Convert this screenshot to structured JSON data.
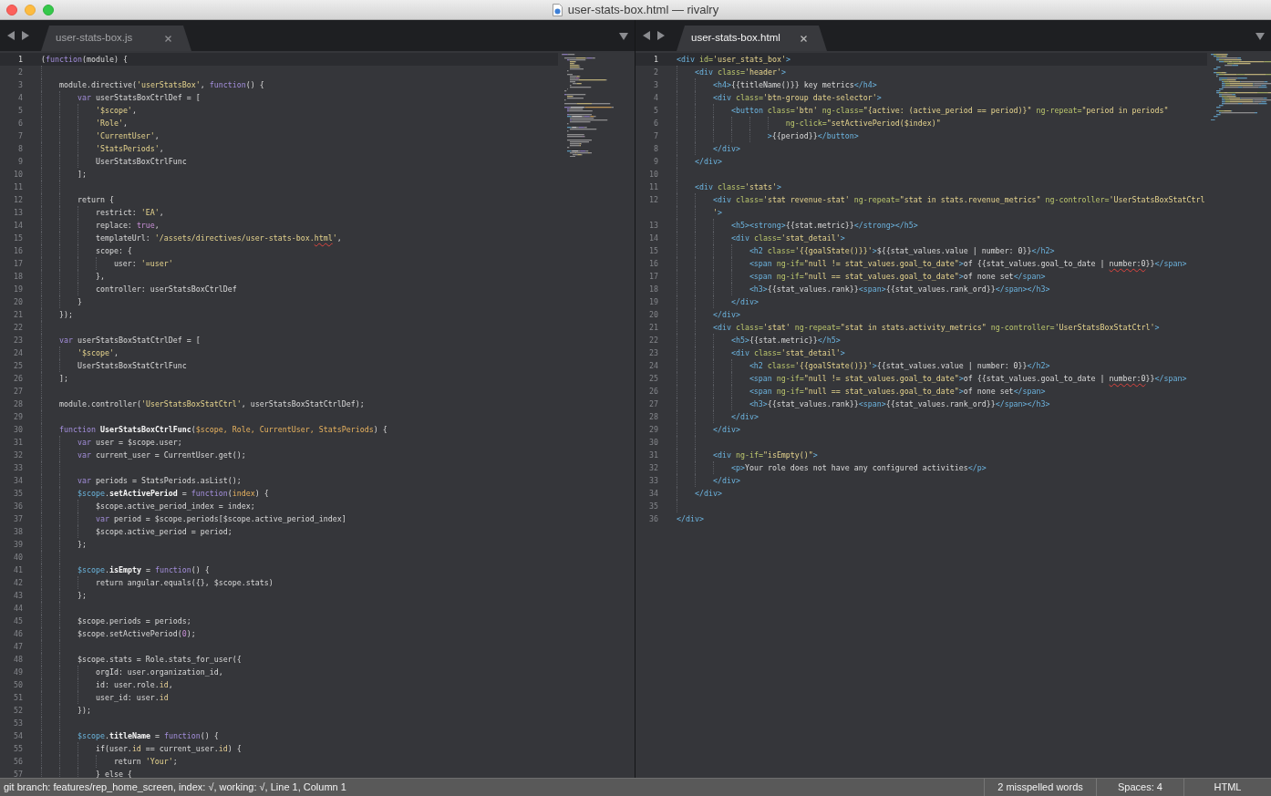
{
  "window": {
    "title": "user-stats-box.html — rivalry"
  },
  "panes": [
    {
      "tab": {
        "label": "user-stats-box.js",
        "focused": false
      },
      "lines": [
        {
          "number": "1",
          "current": true,
          "tokens": [
            {
              "kind": "plain",
              "text": "("
            },
            {
              "kind": "keyword",
              "text": "function"
            },
            {
              "kind": "plain",
              "text": "(module) {"
            }
          ]
        },
        {
          "number": "2",
          "current": false
        },
        {
          "number": "3",
          "current": false,
          "tokens": [
            {
              "kind": "plain",
              "text": "    module.directive("
            },
            {
              "kind": "string",
              "text": "'userStatsBox'"
            },
            {
              "kind": "plain",
              "text": ", "
            },
            {
              "kind": "keyword",
              "text": "function"
            },
            {
              "kind": "plain",
              "text": "() {"
            }
          ]
        },
        {
          "number": "4",
          "current": false,
          "tokens": [
            {
              "kind": "keyword",
              "text": "        var"
            },
            {
              "kind": "plain",
              "text": " userStatsBoxCtrlDef = ["
            }
          ]
        },
        {
          "number": "5",
          "current": false,
          "tokens": [
            {
              "kind": "string",
              "text": "            '$scope'"
            },
            {
              "kind": "plain",
              "text": ","
            }
          ]
        },
        {
          "number": "6",
          "current": false,
          "tokens": [
            {
              "kind": "string",
              "text": "            'Role'"
            },
            {
              "kind": "plain",
              "text": ","
            }
          ]
        },
        {
          "number": "7",
          "current": false,
          "tokens": [
            {
              "kind": "string",
              "text": "            'CurrentUser'"
            },
            {
              "kind": "plain",
              "text": ","
            }
          ]
        },
        {
          "number": "8",
          "current": false,
          "tokens": [
            {
              "kind": "string",
              "text": "            'StatsPeriods'"
            },
            {
              "kind": "plain",
              "text": ","
            }
          ]
        },
        {
          "number": "9",
          "current": false,
          "tokens": [
            {
              "kind": "plain",
              "text": "            UserStatsBoxCtrlFunc"
            }
          ]
        },
        {
          "number": "10",
          "current": false,
          "tokens": [
            {
              "kind": "plain",
              "text": "        ];"
            }
          ]
        },
        {
          "number": "11",
          "current": false
        },
        {
          "number": "12",
          "current": false,
          "tokens": [
            {
              "kind": "plain",
              "text": "        return {"
            }
          ]
        },
        {
          "number": "13",
          "current": false,
          "tokens": [
            {
              "kind": "plain",
              "text": "            restrict: "
            },
            {
              "kind": "string",
              "text": "'EA'"
            },
            {
              "kind": "plain",
              "text": ","
            }
          ]
        },
        {
          "number": "14",
          "current": false,
          "tokens": [
            {
              "kind": "plain",
              "text": "            replace: "
            },
            {
              "kind": "constant",
              "text": "true"
            },
            {
              "kind": "plain",
              "text": ","
            }
          ]
        },
        {
          "number": "15",
          "current": false,
          "tokens": [
            {
              "kind": "plain",
              "text": "            templateUrl: "
            },
            {
              "kind": "string",
              "text": "'/assets/directives/user-stats-box."
            },
            {
              "kind": "misspelled_string",
              "text": "html"
            },
            {
              "kind": "string",
              "text": "'"
            },
            {
              "kind": "plain",
              "text": ","
            }
          ]
        },
        {
          "number": "16",
          "current": false,
          "tokens": [
            {
              "kind": "plain",
              "text": "            scope: {"
            }
          ]
        },
        {
          "number": "17",
          "current": false,
          "tokens": [
            {
              "kind": "plain",
              "text": "                user: "
            },
            {
              "kind": "string",
              "text": "'=user'"
            }
          ]
        },
        {
          "number": "18",
          "current": false,
          "tokens": [
            {
              "kind": "plain",
              "text": "            },"
            }
          ]
        },
        {
          "number": "19",
          "current": false,
          "tokens": [
            {
              "kind": "plain",
              "text": "            controller: userStatsBoxCtrlDef"
            }
          ]
        },
        {
          "number": "20",
          "current": false,
          "tokens": [
            {
              "kind": "plain",
              "text": "        }"
            }
          ]
        },
        {
          "number": "21",
          "current": false,
          "tokens": [
            {
              "kind": "plain",
              "text": "    });"
            }
          ]
        },
        {
          "number": "22",
          "current": false
        },
        {
          "number": "23",
          "current": false,
          "tokens": [
            {
              "kind": "keyword",
              "text": "    var"
            },
            {
              "kind": "plain",
              "text": " userStatsBoxStatCtrlDef = ["
            }
          ]
        },
        {
          "number": "24",
          "current": false,
          "tokens": [
            {
              "kind": "string",
              "text": "        '$scope'"
            },
            {
              "kind": "plain",
              "text": ","
            }
          ]
        },
        {
          "number": "25",
          "current": false,
          "tokens": [
            {
              "kind": "plain",
              "text": "        UserStatsBoxStatCtrlFunc"
            }
          ]
        },
        {
          "number": "26",
          "current": false,
          "tokens": [
            {
              "kind": "plain",
              "text": "    ];"
            }
          ]
        },
        {
          "number": "27",
          "current": false
        },
        {
          "number": "28",
          "current": false,
          "tokens": [
            {
              "kind": "plain",
              "text": "    module.controller("
            },
            {
              "kind": "string",
              "text": "'UserStatsBoxStatCtrl'"
            },
            {
              "kind": "plain",
              "text": ", userStatsBoxStatCtrlDef);"
            }
          ]
        },
        {
          "number": "29",
          "current": false
        },
        {
          "number": "30",
          "current": false,
          "tokens": [
            {
              "kind": "keyword",
              "text": "    function "
            },
            {
              "kind": "entity",
              "text": "UserStatsBoxCtrlFunc"
            },
            {
              "kind": "plain",
              "text": "("
            },
            {
              "kind": "param",
              "text": "$scope, Role, CurrentUser, StatsPeriods"
            },
            {
              "kind": "plain",
              "text": ") {"
            }
          ]
        },
        {
          "number": "31",
          "current": false,
          "tokens": [
            {
              "kind": "keyword",
              "text": "        var"
            },
            {
              "kind": "plain",
              "text": " user = $scope.user;"
            }
          ]
        },
        {
          "number": "32",
          "current": false,
          "tokens": [
            {
              "kind": "keyword",
              "text": "        var"
            },
            {
              "kind": "plain",
              "text": " current_user = CurrentUser.get();"
            }
          ]
        },
        {
          "number": "33",
          "current": false
        },
        {
          "number": "34",
          "current": false,
          "tokens": [
            {
              "kind": "keyword",
              "text": "        var"
            },
            {
              "kind": "plain",
              "text": " periods = StatsPeriods.asList();"
            }
          ]
        },
        {
          "number": "35",
          "current": false,
          "tokens": [
            {
              "kind": "variable",
              "text": "        $scope"
            },
            {
              "kind": "plain",
              "text": "."
            },
            {
              "kind": "entity",
              "text": "setActivePeriod"
            },
            {
              "kind": "plain",
              "text": " = "
            },
            {
              "kind": "keyword",
              "text": "function"
            },
            {
              "kind": "plain",
              "text": "("
            },
            {
              "kind": "param",
              "text": "index"
            },
            {
              "kind": "plain",
              "text": ") {"
            }
          ]
        },
        {
          "number": "36",
          "current": false,
          "tokens": [
            {
              "kind": "plain",
              "text": "            $scope.active_period_index = index;"
            }
          ]
        },
        {
          "number": "37",
          "current": false,
          "tokens": [
            {
              "kind": "keyword",
              "text": "            var"
            },
            {
              "kind": "plain",
              "text": " period = $scope.periods[$scope.active_period_index]"
            }
          ]
        },
        {
          "number": "38",
          "current": false,
          "tokens": [
            {
              "kind": "plain",
              "text": "            $scope.active_period = period;"
            }
          ]
        },
        {
          "number": "39",
          "current": false,
          "tokens": [
            {
              "kind": "plain",
              "text": "        };"
            }
          ]
        },
        {
          "number": "40",
          "current": false
        },
        {
          "number": "41",
          "current": false,
          "tokens": [
            {
              "kind": "variable",
              "text": "        $scope"
            },
            {
              "kind": "plain",
              "text": "."
            },
            {
              "kind": "entity",
              "text": "isEmpty"
            },
            {
              "kind": "plain",
              "text": " = "
            },
            {
              "kind": "keyword",
              "text": "function"
            },
            {
              "kind": "plain",
              "text": "() {"
            }
          ]
        },
        {
          "number": "42",
          "current": false,
          "tokens": [
            {
              "kind": "plain",
              "text": "            return angular.equals({}, $scope.stats)"
            }
          ]
        },
        {
          "number": "43",
          "current": false,
          "tokens": [
            {
              "kind": "plain",
              "text": "        };"
            }
          ]
        },
        {
          "number": "44",
          "current": false
        },
        {
          "number": "45",
          "current": false,
          "tokens": [
            {
              "kind": "plain",
              "text": "        $scope.periods = periods;"
            }
          ]
        },
        {
          "number": "46",
          "current": false,
          "tokens": [
            {
              "kind": "plain",
              "text": "        $scope.setActivePeriod("
            },
            {
              "kind": "constant",
              "text": "0"
            },
            {
              "kind": "plain",
              "text": ");"
            }
          ]
        },
        {
          "number": "47",
          "current": false
        },
        {
          "number": "48",
          "current": false,
          "tokens": [
            {
              "kind": "plain",
              "text": "        $scope.stats = Role.stats_for_user({"
            }
          ]
        },
        {
          "number": "49",
          "current": false,
          "tokens": [
            {
              "kind": "plain",
              "text": "            orgId: user.organization_id,"
            }
          ]
        },
        {
          "number": "50",
          "current": false,
          "tokens": [
            {
              "kind": "plain",
              "text": "            id: user.role."
            },
            {
              "kind": "property",
              "text": "id"
            },
            {
              "kind": "plain",
              "text": ","
            }
          ]
        },
        {
          "number": "51",
          "current": false,
          "tokens": [
            {
              "kind": "plain",
              "text": "            user_id: user."
            },
            {
              "kind": "property",
              "text": "id"
            }
          ]
        },
        {
          "number": "52",
          "current": false,
          "tokens": [
            {
              "kind": "plain",
              "text": "        });"
            }
          ]
        },
        {
          "number": "53",
          "current": false
        },
        {
          "number": "54",
          "current": false,
          "tokens": [
            {
              "kind": "variable",
              "text": "        $scope"
            },
            {
              "kind": "plain",
              "text": "."
            },
            {
              "kind": "entity",
              "text": "titleName"
            },
            {
              "kind": "plain",
              "text": " = "
            },
            {
              "kind": "keyword",
              "text": "function"
            },
            {
              "kind": "plain",
              "text": "() {"
            }
          ]
        },
        {
          "number": "55",
          "current": false,
          "tokens": [
            {
              "kind": "plain",
              "text": "            if(user."
            },
            {
              "kind": "property",
              "text": "id"
            },
            {
              "kind": "plain",
              "text": " == current_user."
            },
            {
              "kind": "property",
              "text": "id"
            },
            {
              "kind": "plain",
              "text": ") {"
            }
          ]
        },
        {
          "number": "56",
          "current": false,
          "tokens": [
            {
              "kind": "plain",
              "text": "                return "
            },
            {
              "kind": "string",
              "text": "'Your'"
            },
            {
              "kind": "plain",
              "text": ";"
            }
          ]
        },
        {
          "number": "57",
          "current": false,
          "tokens": [
            {
              "kind": "plain",
              "text": "            } else {"
            }
          ]
        }
      ]
    },
    {
      "tab": {
        "label": "user-stats-box.html",
        "focused": true
      },
      "lines": [
        {
          "number": "1",
          "current": true,
          "tokens": [
            {
              "kind": "tag",
              "text": "<div"
            },
            {
              "kind": "attr",
              "text": " id="
            },
            {
              "kind": "string",
              "text": "'user_stats_box'"
            },
            {
              "kind": "tag",
              "text": ">"
            }
          ]
        },
        {
          "number": "2",
          "current": false,
          "tokens": [
            {
              "kind": "tag",
              "text": "    <div"
            },
            {
              "kind": "attr",
              "text": " class="
            },
            {
              "kind": "string",
              "text": "'header'"
            },
            {
              "kind": "tag",
              "text": ">"
            }
          ]
        },
        {
          "number": "3",
          "current": false,
          "tokens": [
            {
              "kind": "tag",
              "text": "        <h4>"
            },
            {
              "kind": "plain",
              "text": "{{titleName()}} key metrics"
            },
            {
              "kind": "tag",
              "text": "</h4>"
            }
          ]
        },
        {
          "number": "4",
          "current": false,
          "tokens": [
            {
              "kind": "tag",
              "text": "        <div"
            },
            {
              "kind": "attr",
              "text": " class="
            },
            {
              "kind": "string",
              "text": "'btn-group date-selector'"
            },
            {
              "kind": "tag",
              "text": ">"
            }
          ]
        },
        {
          "number": "5",
          "current": false,
          "tokens": [
            {
              "kind": "tag",
              "text": "            <button"
            },
            {
              "kind": "attr",
              "text": " class="
            },
            {
              "kind": "string",
              "text": "'btn'"
            },
            {
              "kind": "attr",
              "text": " ng-class="
            },
            {
              "kind": "string",
              "text": "\"{active: (active_period == period)}\""
            },
            {
              "kind": "attr",
              "text": " ng-repeat="
            },
            {
              "kind": "string",
              "text": "\"period in periods\""
            }
          ]
        },
        {
          "number": "6",
          "current": false,
          "tokens": [
            {
              "kind": "attr",
              "text": "                        ng-click="
            },
            {
              "kind": "string",
              "text": "\"setActivePeriod($index)\""
            }
          ]
        },
        {
          "number": "7",
          "current": false,
          "tokens": [
            {
              "kind": "tag",
              "text": "                    >"
            },
            {
              "kind": "plain",
              "text": "{{period}}"
            },
            {
              "kind": "tag",
              "text": "</button>"
            }
          ]
        },
        {
          "number": "8",
          "current": false,
          "tokens": [
            {
              "kind": "tag",
              "text": "        </div>"
            }
          ]
        },
        {
          "number": "9",
          "current": false,
          "tokens": [
            {
              "kind": "tag",
              "text": "    </div>"
            }
          ]
        },
        {
          "number": "10",
          "current": false
        },
        {
          "number": "11",
          "current": false,
          "tokens": [
            {
              "kind": "tag",
              "text": "    <div"
            },
            {
              "kind": "attr",
              "text": " class="
            },
            {
              "kind": "string",
              "text": "'stats'"
            },
            {
              "kind": "tag",
              "text": ">"
            }
          ]
        },
        {
          "number": "12",
          "current": false,
          "tokens": [
            {
              "kind": "tag",
              "text": "        <div"
            },
            {
              "kind": "attr",
              "text": " class="
            },
            {
              "kind": "string",
              "text": "'stat revenue-stat'"
            },
            {
              "kind": "attr",
              "text": " ng-repeat="
            },
            {
              "kind": "string",
              "text": "\"stat in stats.revenue_metrics\""
            },
            {
              "kind": "attr",
              "text": " ng-controller="
            },
            {
              "kind": "string",
              "text": "'UserStatsBoxStatCtrl"
            }
          ],
          "wrap": [
            {
              "kind": "string",
              "text": "'"
            },
            {
              "kind": "tag",
              "text": ">"
            }
          ]
        },
        {
          "number": "13",
          "current": false,
          "tokens": [
            {
              "kind": "tag",
              "text": "            <h5><strong>"
            },
            {
              "kind": "plain",
              "text": "{{stat.metric}}"
            },
            {
              "kind": "tag",
              "text": "</strong></h5>"
            }
          ]
        },
        {
          "number": "14",
          "current": false,
          "tokens": [
            {
              "kind": "tag",
              "text": "            <div"
            },
            {
              "kind": "attr",
              "text": " class="
            },
            {
              "kind": "string",
              "text": "'stat_detail'"
            },
            {
              "kind": "tag",
              "text": ">"
            }
          ]
        },
        {
          "number": "15",
          "current": false,
          "tokens": [
            {
              "kind": "tag",
              "text": "                <h2"
            },
            {
              "kind": "attr",
              "text": " class="
            },
            {
              "kind": "string",
              "text": "'{{goalState()}}'"
            },
            {
              "kind": "tag",
              "text": ">"
            },
            {
              "kind": "plain",
              "text": "${{stat_values.value | number: 0}}"
            },
            {
              "kind": "tag",
              "text": "</h2>"
            }
          ]
        },
        {
          "number": "16",
          "current": false,
          "tokens": [
            {
              "kind": "tag",
              "text": "                <span"
            },
            {
              "kind": "attr",
              "text": " ng-if="
            },
            {
              "kind": "string",
              "text": "\"null != stat_values.goal_to_date\""
            },
            {
              "kind": "tag",
              "text": ">"
            },
            {
              "kind": "plain",
              "text": "of {{stat_values.goal_to_date | "
            },
            {
              "kind": "misspelled_plain",
              "text": "number:0"
            },
            {
              "kind": "plain",
              "text": "}}"
            },
            {
              "kind": "tag",
              "text": "</span>"
            }
          ]
        },
        {
          "number": "17",
          "current": false,
          "tokens": [
            {
              "kind": "tag",
              "text": "                <span"
            },
            {
              "kind": "attr",
              "text": " ng-if="
            },
            {
              "kind": "string",
              "text": "\"null == stat_values.goal_to_date\""
            },
            {
              "kind": "tag",
              "text": ">"
            },
            {
              "kind": "plain",
              "text": "of none set"
            },
            {
              "kind": "tag",
              "text": "</span>"
            }
          ]
        },
        {
          "number": "18",
          "current": false,
          "tokens": [
            {
              "kind": "tag",
              "text": "                <h3>"
            },
            {
              "kind": "plain",
              "text": "{{stat_values.rank}}"
            },
            {
              "kind": "tag",
              "text": "<span>"
            },
            {
              "kind": "plain",
              "text": "{{stat_values.rank_ord}}"
            },
            {
              "kind": "tag",
              "text": "</span></h3>"
            }
          ]
        },
        {
          "number": "19",
          "current": false,
          "tokens": [
            {
              "kind": "tag",
              "text": "            </div>"
            }
          ]
        },
        {
          "number": "20",
          "current": false,
          "tokens": [
            {
              "kind": "tag",
              "text": "        </div>"
            }
          ]
        },
        {
          "number": "21",
          "current": false,
          "tokens": [
            {
              "kind": "tag",
              "text": "        <div"
            },
            {
              "kind": "attr",
              "text": " class="
            },
            {
              "kind": "string",
              "text": "'stat'"
            },
            {
              "kind": "attr",
              "text": " ng-repeat="
            },
            {
              "kind": "string",
              "text": "\"stat in stats.activity_metrics\""
            },
            {
              "kind": "attr",
              "text": " ng-controller="
            },
            {
              "kind": "string",
              "text": "'UserStatsBoxStatCtrl'"
            },
            {
              "kind": "tag",
              "text": ">"
            }
          ]
        },
        {
          "number": "22",
          "current": false,
          "tokens": [
            {
              "kind": "tag",
              "text": "            <h5>"
            },
            {
              "kind": "plain",
              "text": "{{stat.metric}}"
            },
            {
              "kind": "tag",
              "text": "</h5>"
            }
          ]
        },
        {
          "number": "23",
          "current": false,
          "tokens": [
            {
              "kind": "tag",
              "text": "            <div"
            },
            {
              "kind": "attr",
              "text": " class="
            },
            {
              "kind": "string",
              "text": "'stat_detail'"
            },
            {
              "kind": "tag",
              "text": ">"
            }
          ]
        },
        {
          "number": "24",
          "current": false,
          "tokens": [
            {
              "kind": "tag",
              "text": "                <h2"
            },
            {
              "kind": "attr",
              "text": " class="
            },
            {
              "kind": "string",
              "text": "'{{goalState()}}'"
            },
            {
              "kind": "tag",
              "text": ">"
            },
            {
              "kind": "plain",
              "text": "{{stat_values.value | number: 0}}"
            },
            {
              "kind": "tag",
              "text": "</h2>"
            }
          ]
        },
        {
          "number": "25",
          "current": false,
          "tokens": [
            {
              "kind": "tag",
              "text": "                <span"
            },
            {
              "kind": "attr",
              "text": " ng-if="
            },
            {
              "kind": "string",
              "text": "\"null != stat_values.goal_to_date\""
            },
            {
              "kind": "tag",
              "text": ">"
            },
            {
              "kind": "plain",
              "text": "of {{stat_values.goal_to_date | "
            },
            {
              "kind": "misspelled_plain",
              "text": "number:0"
            },
            {
              "kind": "plain",
              "text": "}}"
            },
            {
              "kind": "tag",
              "text": "</span>"
            }
          ]
        },
        {
          "number": "26",
          "current": false,
          "tokens": [
            {
              "kind": "tag",
              "text": "                <span"
            },
            {
              "kind": "attr",
              "text": " ng-if="
            },
            {
              "kind": "string",
              "text": "\"null == stat_values.goal_to_date\""
            },
            {
              "kind": "tag",
              "text": ">"
            },
            {
              "kind": "plain",
              "text": "of none set"
            },
            {
              "kind": "tag",
              "text": "</span>"
            }
          ]
        },
        {
          "number": "27",
          "current": false,
          "tokens": [
            {
              "kind": "tag",
              "text": "                <h3>"
            },
            {
              "kind": "plain",
              "text": "{{stat_values.rank}}"
            },
            {
              "kind": "tag",
              "text": "<span>"
            },
            {
              "kind": "plain",
              "text": "{{stat_values.rank_ord}}"
            },
            {
              "kind": "tag",
              "text": "</span></h3>"
            }
          ]
        },
        {
          "number": "28",
          "current": false,
          "tokens": [
            {
              "kind": "tag",
              "text": "            </div>"
            }
          ]
        },
        {
          "number": "29",
          "current": false,
          "tokens": [
            {
              "kind": "tag",
              "text": "        </div>"
            }
          ]
        },
        {
          "number": "30",
          "current": false
        },
        {
          "number": "31",
          "current": false,
          "tokens": [
            {
              "kind": "tag",
              "text": "        <div"
            },
            {
              "kind": "attr",
              "text": " ng-if="
            },
            {
              "kind": "string",
              "text": "\"isEmpty()\""
            },
            {
              "kind": "tag",
              "text": ">"
            }
          ]
        },
        {
          "number": "32",
          "current": false,
          "tokens": [
            {
              "kind": "tag",
              "text": "            <p>"
            },
            {
              "kind": "plain",
              "text": "Your role does not have any configured activities"
            },
            {
              "kind": "tag",
              "text": "</p>"
            }
          ]
        },
        {
          "number": "33",
          "current": false,
          "tokens": [
            {
              "kind": "tag",
              "text": "        </div>"
            }
          ]
        },
        {
          "number": "34",
          "current": false,
          "tokens": [
            {
              "kind": "tag",
              "text": "    </div>"
            }
          ]
        },
        {
          "number": "35",
          "current": false
        },
        {
          "number": "36",
          "current": false,
          "tokens": [
            {
              "kind": "tag",
              "text": "</div>"
            }
          ]
        }
      ]
    }
  ],
  "status_bar": {
    "text": "git branch: features/rep_home_screen, index: √, working: √, Line 1, Column 1",
    "items": [
      {
        "kind": "message",
        "text": "2 misspelled words"
      },
      {
        "kind": "menu",
        "text": "Spaces: 4"
      },
      {
        "kind": "menu",
        "text": "HTML"
      }
    ]
  }
}
